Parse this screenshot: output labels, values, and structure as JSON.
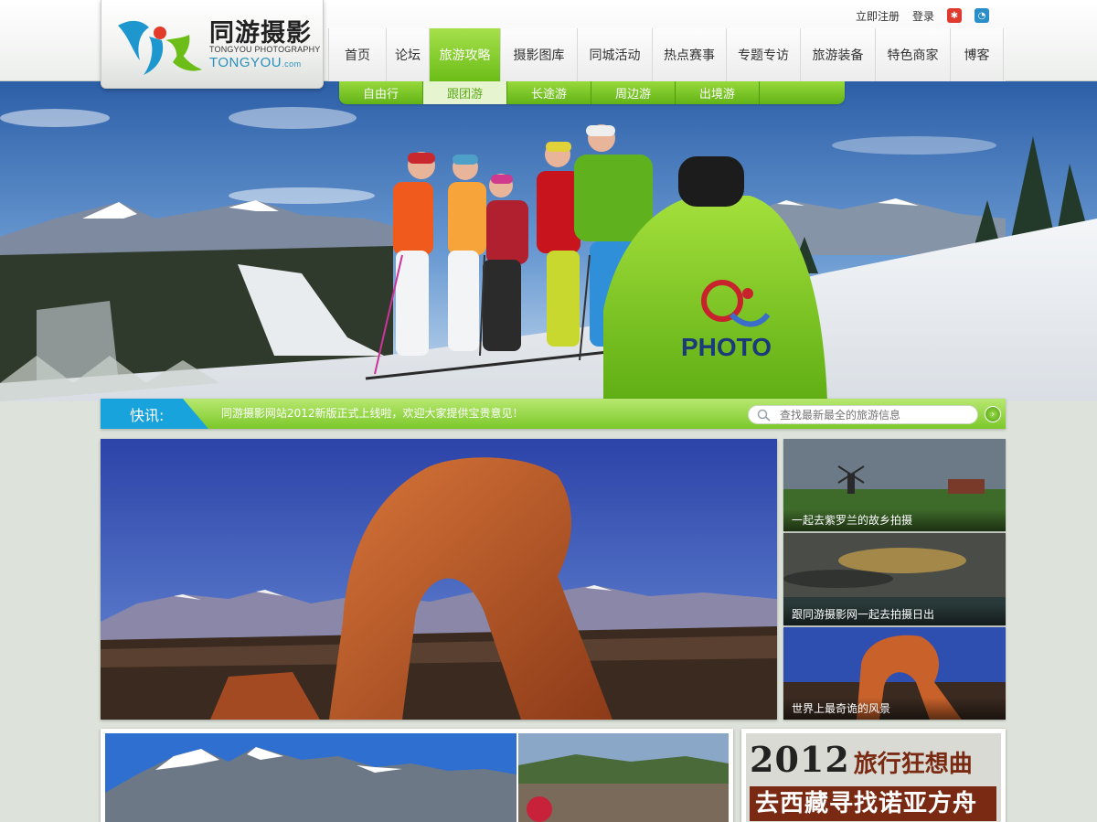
{
  "header": {
    "logo": {
      "cn": "同游摄影",
      "en_line1": "TONGYOU PHOTOGRAPHY",
      "en_line2": "TONGYOU",
      "en_line2_suffix": ".com"
    },
    "links": {
      "register": "立即注册",
      "login": "登录"
    },
    "sns_icons": [
      "weibo-icon",
      "tencent-weibo-icon"
    ]
  },
  "nav": {
    "items": [
      {
        "label": "首页"
      },
      {
        "label": "论坛"
      },
      {
        "label": "旅游攻略"
      },
      {
        "label": "摄影图库"
      },
      {
        "label": "同城活动"
      },
      {
        "label": "热点赛事"
      },
      {
        "label": "专题专访"
      },
      {
        "label": "旅游装备"
      },
      {
        "label": "特色商家"
      },
      {
        "label": "博客"
      }
    ],
    "active_index": 2
  },
  "subnav": {
    "items": [
      {
        "label": "自由行"
      },
      {
        "label": "跟团游"
      },
      {
        "label": "长途游"
      },
      {
        "label": "周边游"
      },
      {
        "label": "出境游"
      }
    ],
    "active_index": 1
  },
  "hero": {
    "jacket_text": "PHOTO"
  },
  "ticker": {
    "label": "快讯:",
    "text": "同游摄影网站2012新版正式上线啦，欢迎大家提供宝贵意见！",
    "search_placeholder": "查找最新最全的旅游信息",
    "go_icon": "arrow-right-icon"
  },
  "thumbs": [
    {
      "caption": "一起去紫罗兰的故乡拍摄"
    },
    {
      "caption": "跟同游摄影网一起去拍摄日出"
    },
    {
      "caption": "世界上最奇诡的风景"
    }
  ],
  "promo": {
    "year": "2012",
    "title": "旅行狂想曲",
    "subtitle": "去西藏寻找诺亚方舟"
  },
  "colors": {
    "accent_green": "#7cc82a",
    "ticker_blue": "#18a3dc",
    "promo_brown": "#7a2a12"
  }
}
